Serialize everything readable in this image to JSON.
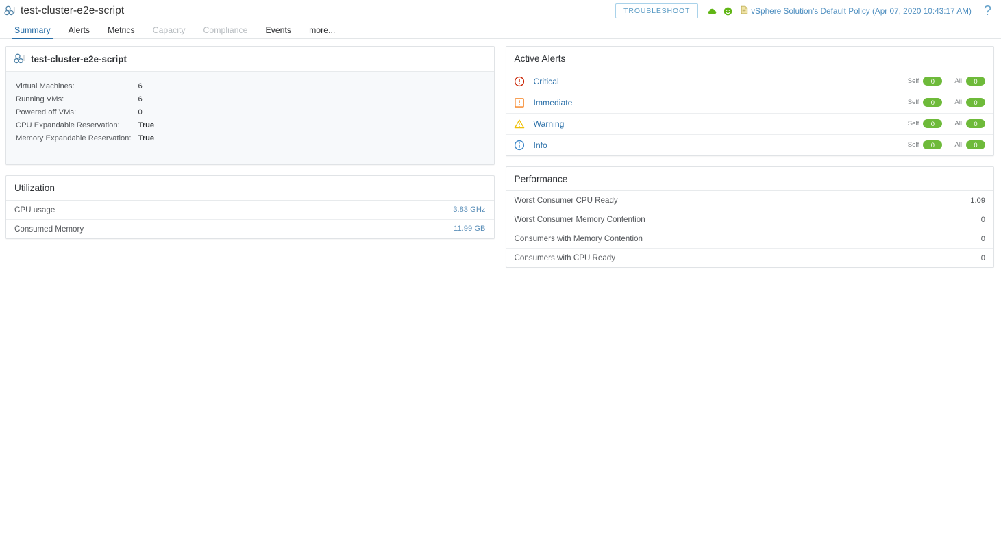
{
  "header": {
    "object_icon": "cluster-icon",
    "object_title": "test-cluster-e2e-script",
    "troubleshoot_label": "TROUBLESHOOT",
    "status_icons": [
      "cloud-green-icon",
      "smiley-green-icon"
    ],
    "policy_icon": "policy-document-icon",
    "policy_text": "vSphere Solution's Default Policy (Apr 07, 2020 10:43:17 AM)",
    "help_label": "?"
  },
  "tabs": [
    {
      "label": "Summary",
      "active": true,
      "disabled": false
    },
    {
      "label": "Alerts",
      "active": false,
      "disabled": false
    },
    {
      "label": "Metrics",
      "active": false,
      "disabled": false
    },
    {
      "label": "Capacity",
      "active": false,
      "disabled": true
    },
    {
      "label": "Compliance",
      "active": false,
      "disabled": true
    },
    {
      "label": "Events",
      "active": false,
      "disabled": false
    },
    {
      "label": "more...",
      "active": false,
      "disabled": false
    }
  ],
  "object_card": {
    "name": "test-cluster-e2e-script",
    "icon": "cluster-icon",
    "properties": [
      {
        "key": "Virtual Machines:",
        "value": "6",
        "bold": false
      },
      {
        "key": "Running VMs:",
        "value": "6",
        "bold": false
      },
      {
        "key": "Powered off VMs:",
        "value": "0",
        "bold": false
      },
      {
        "key": "CPU Expandable Reservation:",
        "value": "True",
        "bold": true
      },
      {
        "key": "Memory Expandable Reservation:",
        "value": "True",
        "bold": true
      }
    ]
  },
  "utilization": {
    "title": "Utilization",
    "rows": [
      {
        "label": "CPU usage",
        "value": "3.83 GHz"
      },
      {
        "label": "Consumed Memory",
        "value": "11.99 GB"
      }
    ]
  },
  "active_alerts": {
    "title": "Active Alerts",
    "self_label": "Self",
    "all_label": "All",
    "rows": [
      {
        "severity": "Critical",
        "icon": "critical-alert-icon",
        "self": "0",
        "all": "0"
      },
      {
        "severity": "Immediate",
        "icon": "immediate-alert-icon",
        "self": "0",
        "all": "0"
      },
      {
        "severity": "Warning",
        "icon": "warning-alert-icon",
        "self": "0",
        "all": "0"
      },
      {
        "severity": "Info",
        "icon": "info-alert-icon",
        "self": "0",
        "all": "0"
      }
    ]
  },
  "performance": {
    "title": "Performance",
    "rows": [
      {
        "label": "Worst Consumer CPU Ready",
        "value": "1.09"
      },
      {
        "label": "Worst Consumer Memory Contention",
        "value": "0"
      },
      {
        "label": "Consumers with Memory Contention",
        "value": "0"
      },
      {
        "label": "Consumers with CPU Ready",
        "value": "0"
      }
    ]
  },
  "colors": {
    "accent_blue": "#2a6fa8",
    "link_blue": "#4f8fc0",
    "badge_green": "#6eba3a",
    "critical_red": "#c92100",
    "immediate_orange": "#f5811f",
    "warning_yellow": "#efc006",
    "info_blue": "#3b86c8"
  }
}
